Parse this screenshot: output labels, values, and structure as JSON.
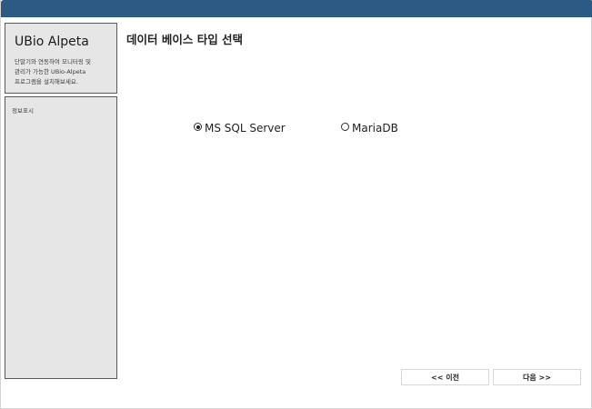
{
  "sidebar": {
    "app_name": "UBio Alpeta",
    "description": "단말기와 연동하여 모니터링 및\n관리가 가능한 UBio-Alpeta\n프로그램을 설치해보세요.",
    "info_label": "정보표시"
  },
  "main": {
    "title": "데이터 베이스 타입 선택",
    "options": [
      {
        "label": "MS SQL Server",
        "selected": true
      },
      {
        "label": "MariaDB",
        "selected": false
      }
    ]
  },
  "footer": {
    "prev_label": "<< 이전",
    "next_label": "다음 >>"
  },
  "colors": {
    "title_bar": "#2c5a85",
    "panel_bg": "#e6e6e6"
  }
}
